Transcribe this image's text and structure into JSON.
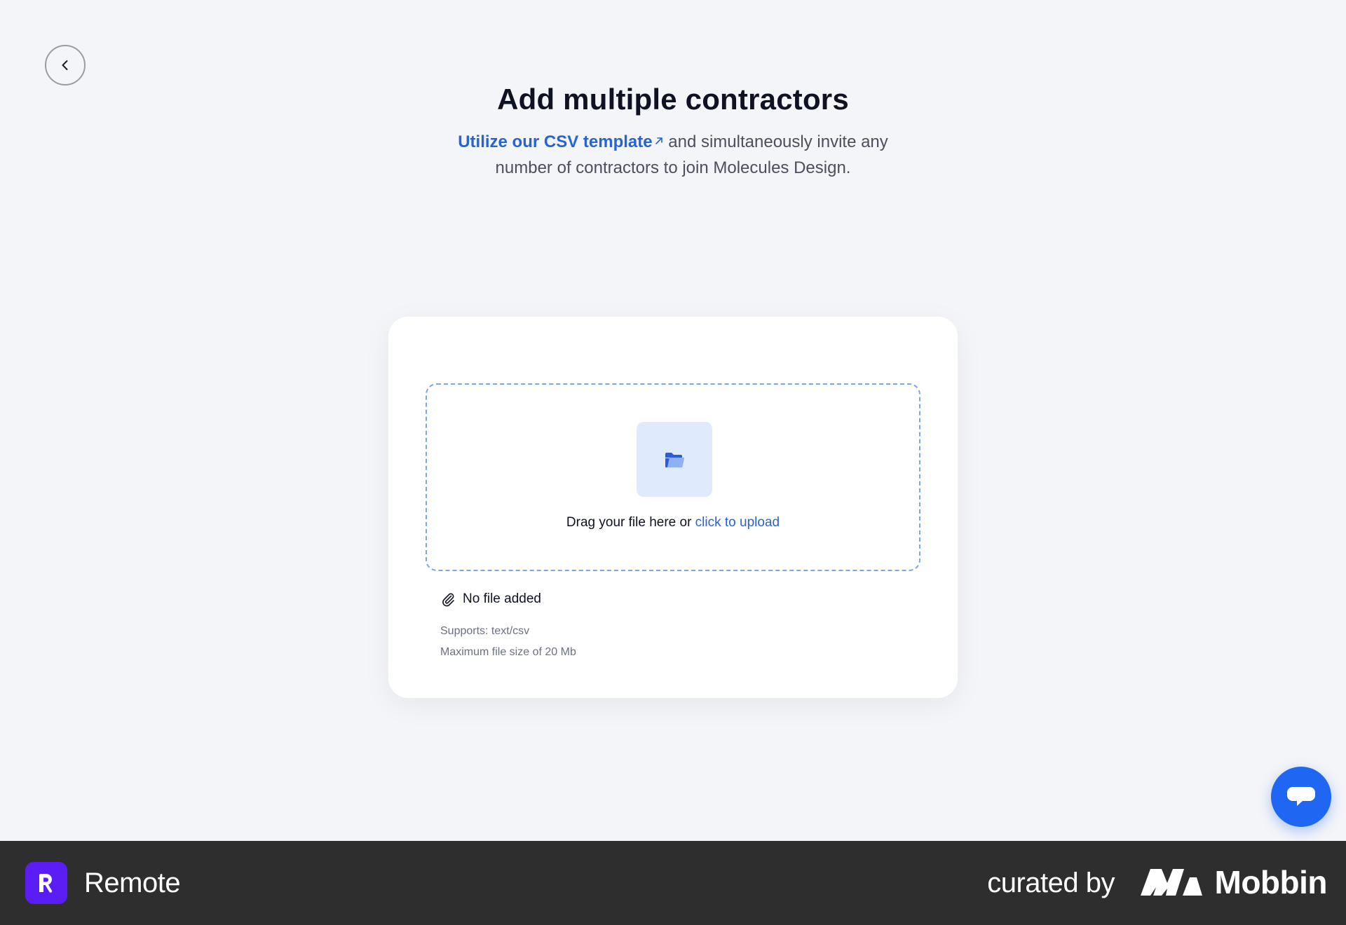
{
  "header": {
    "title": "Add multiple contractors",
    "template_link": "Utilize our CSV template",
    "subtitle_rest": " and simultaneously invite any number of contractors to join Molecules Design."
  },
  "uploader": {
    "drop_text": "Drag your file here or ",
    "upload_link": "click to upload",
    "file_status": "No file added",
    "supports": "Supports: text/csv",
    "max_size": "Maximum file size of 20 Mb"
  },
  "icons": {
    "back": "chevron-left-icon",
    "external": "arrow-up-right-icon",
    "folder": "folder-icon",
    "attachment": "paperclip-icon",
    "chat": "chat-bubble-icon"
  },
  "colors": {
    "accent": "#2563d6",
    "page_bg": "#f4f5f8",
    "chat_button": "#1f66f2",
    "remote_brand": "#5a1ef5",
    "footer_bg": "#2e2e2e"
  },
  "footer": {
    "app_name": "Remote",
    "curated_by": "curated by",
    "brand": "Mobbin"
  }
}
